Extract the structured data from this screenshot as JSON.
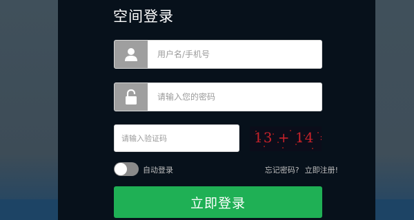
{
  "title": "空间登录",
  "username": {
    "placeholder": "用户名/手机号",
    "icon": "user-icon"
  },
  "password": {
    "placeholder": "请输入您的密码",
    "icon": "lock-icon"
  },
  "captcha": {
    "placeholder": "请输入验证码",
    "image_text": "13 + 14 =",
    "image_question": "?"
  },
  "auto_login": {
    "label": "自动登录",
    "enabled": false
  },
  "links": {
    "forgot": "忘记密码?",
    "register": "立即注册!"
  },
  "submit": {
    "label": "立即登录"
  },
  "colors": {
    "panel_bg": "#07111b",
    "button_bg": "#1fb055",
    "icon_box_bg": "#9f9f9f",
    "captcha_text": "#c8222b"
  }
}
